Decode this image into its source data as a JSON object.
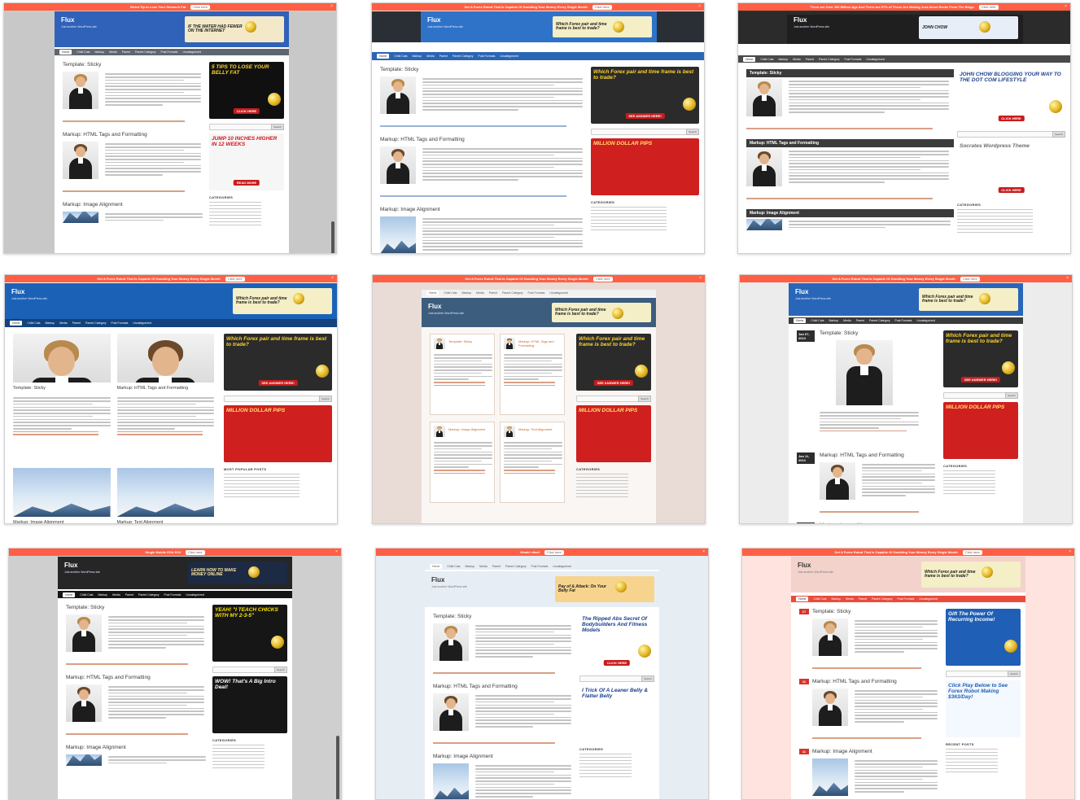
{
  "common": {
    "site_title": "Flux",
    "tagline": "Just another WordPress site",
    "sticky_post": "Template: Sticky",
    "html_post": "Markup: HTML Tags and Formatting",
    "image_post": "Markup: Image Alignment",
    "text_post": "Markup: Text Alignment",
    "search_button": "Search",
    "categories_heading": "CATEGORIES",
    "popular_heading": "MOST POPULAR POSTS",
    "recent_heading": "RECENT POSTS",
    "click_here": "Click here",
    "nav": [
      "Home",
      "Child Cats",
      "Markup",
      "Media",
      "Parent",
      "Parent Category",
      "Post Formats",
      "Uncategorized"
    ]
  },
  "thumbs": [
    {
      "notice": "Weird Tip to Lose Your Stomach Fat",
      "banner": "IF THE WATER HAD FEWER ON THE INTERNET",
      "ad1": {
        "text": "5 TIPS TO LOSE YOUR BELLY FAT",
        "button": "CLICK HERE"
      },
      "ad2": {
        "text": "JUMP 10 INCHES HIGHER IN 12 WEEKS",
        "button": "READ MORE"
      }
    },
    {
      "notice": "Get A Forex Robot That Is Capable Of Doubling Your Money Every Single Month",
      "banner": "Which Forex pair and time frame is best to trade?",
      "ad1": {
        "text": "Which Forex pair and time frame is best to trade?",
        "button": "SEE ANSWER HERE!"
      },
      "ad2": {
        "text": "MILLION DOLLAR PIPS",
        "button": ""
      }
    },
    {
      "notice": "There are Over 100 Million Age And There are 97% of These Are Making Just About Broke From The Blogs",
      "banner": "JOHN CHOW",
      "ad1": {
        "text": "JOHN CHOW BLOGGING YOUR WAY TO THE DOT COM LIFESTYLE",
        "button": "CLICK HERE"
      },
      "ad2": {
        "text": "Socrates Wordpress Theme",
        "button": "CLICK HERE"
      }
    },
    {
      "notice": "Get A Forex Robot That Is Capable Of Doubling Your Money Every Single Month",
      "banner": "Which Forex pair and time frame is best to trade?",
      "ad1": {
        "text": "Which Forex pair and time frame is best to trade?",
        "button": "SEE ANSWER HERE!"
      },
      "ad2": {
        "text": "MILLION DOLLAR PIPS",
        "button": ""
      }
    },
    {
      "notice": "Get A Forex Robot That Is Capable Of Doubling Your Money Every Single Month",
      "banner": "Which Forex pair and time frame is best to trade?",
      "ad1": {
        "text": "Which Forex pair and time frame is best to trade?",
        "button": "SEE ANSWER HERE!"
      },
      "ad2": {
        "text": "MILLION DOLLAR PIPS",
        "button": ""
      }
    },
    {
      "notice": "Get A Forex Robot That Is Capable Of Doubling Your Money Every Single Month",
      "banner": "Which Forex pair and time frame is best to trade?",
      "ad1": {
        "text": "Which Forex pair and time frame is best to trade?",
        "button": "SEE ANSWER HERE!"
      },
      "ad2": {
        "text": "MILLION DOLLAR PIPS",
        "button": ""
      },
      "date1": "Jan 07, 2013",
      "date2": "Jan 11, 2013"
    },
    {
      "notice": "Single Mobile ERA ROI",
      "banner": "LEARN HOW TO MAKE MONEY ONLINE",
      "ad1": {
        "text": "YEAH! \"I TEACH CHICKS WITH MY 2-3-5\"",
        "button": ""
      },
      "ad2": {
        "text": "WOW! That's A Big Intro Deal!",
        "button": ""
      }
    },
    {
      "notice": "Hhatel vitaef",
      "banner": "Pay of & Attack: On Your Belly Fat",
      "ad1": {
        "text": "The Ripped Abs Secret Of Bodybuilders And Fitness Models",
        "button": "CLICK HERE"
      },
      "ad2": {
        "text": "I Trick Of A Leaner Belly & Flatter Belly",
        "button": ""
      }
    },
    {
      "notice": "Get A Forex Robot That Is Capable Of Doubling Your Money Every Single Month",
      "banner": "Which Forex pair and time frame is best to trade?",
      "ad1": {
        "text": "Gift The Power Of Recurring Income!",
        "button": ""
      },
      "ad2": {
        "text": "Click Play Below to See Forex Robot Making $363/Day!",
        "button": ""
      },
      "date1": "27",
      "date2": "11"
    }
  ]
}
